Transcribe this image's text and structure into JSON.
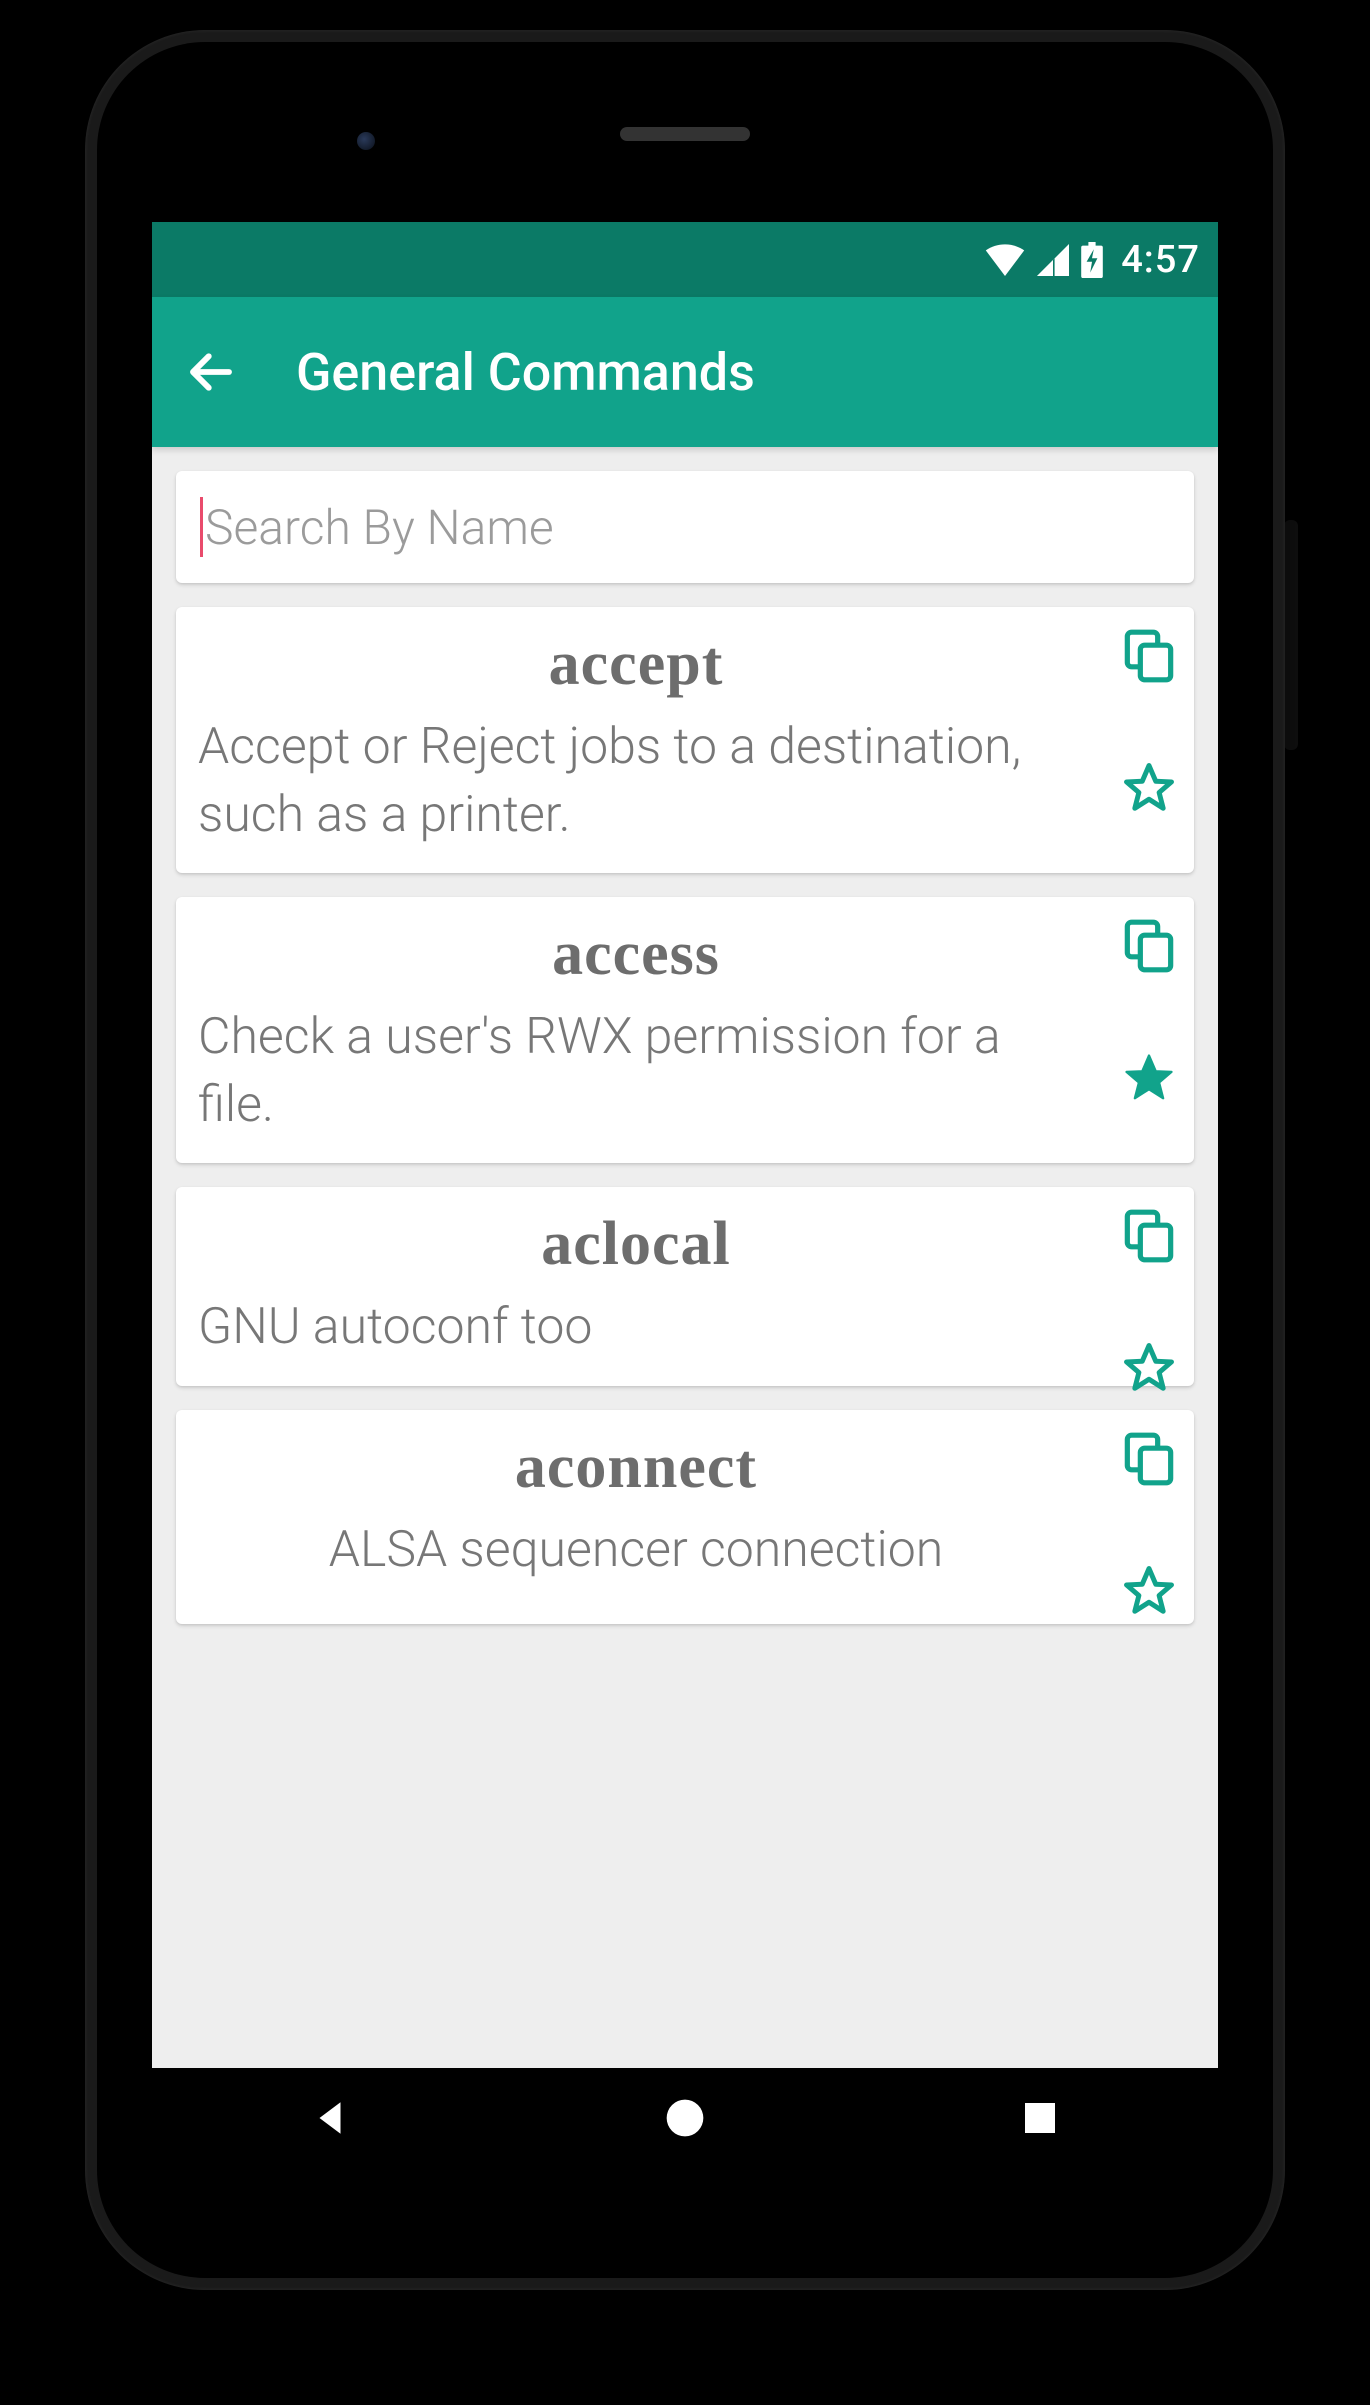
{
  "status": {
    "time": "4:57"
  },
  "appbar": {
    "title": "General Commands"
  },
  "search": {
    "placeholder": "Search By Name"
  },
  "commands": [
    {
      "name": "accept",
      "desc": "Accept or Reject jobs to a destination, such as a printer.",
      "favorited": false
    },
    {
      "name": "access",
      "desc": "Check a user's RWX permission for a file.",
      "favorited": true
    },
    {
      "name": "aclocal",
      "desc": "GNU autoconf too",
      "favorited": false
    },
    {
      "name": "aconnect",
      "desc": "ALSA sequencer connection",
      "favorited": false
    }
  ]
}
